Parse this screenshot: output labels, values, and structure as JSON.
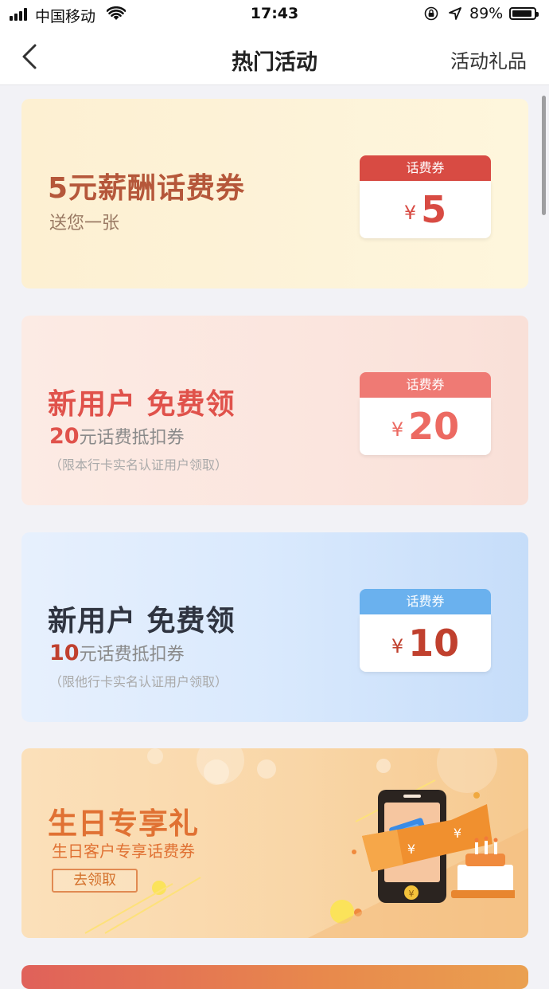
{
  "status_bar": {
    "carrier": "中国移动",
    "time": "17:43",
    "battery": "89%"
  },
  "nav": {
    "title": "热门活动",
    "right_action": "活动礼品"
  },
  "cards": [
    {
      "title": "5元薪酬话费券",
      "subtitle": "送您一张",
      "coupon_tag": "话费券",
      "currency": "¥",
      "amount": "5"
    },
    {
      "title": "新用户  免费领",
      "amount_prefix": "20",
      "subtitle": "元话费抵扣券",
      "note": "（限本行卡实名认证用户领取）",
      "coupon_tag": "话费券",
      "currency": "¥",
      "amount": "20"
    },
    {
      "title": "新用户  免费领",
      "amount_prefix": "10",
      "subtitle": "元话费抵扣券",
      "note": "（限他行卡实名认证用户领取）",
      "coupon_tag": "话费券",
      "currency": "¥",
      "amount": "10"
    },
    {
      "title": "生日专享礼",
      "subtitle": "生日客户专享话费券",
      "button": "去领取",
      "illustration_currency": "¥"
    }
  ],
  "colors": {
    "red": "#d84b43",
    "pink": "#ef7a74",
    "blue": "#6ab1ee",
    "orange": "#e07133"
  }
}
